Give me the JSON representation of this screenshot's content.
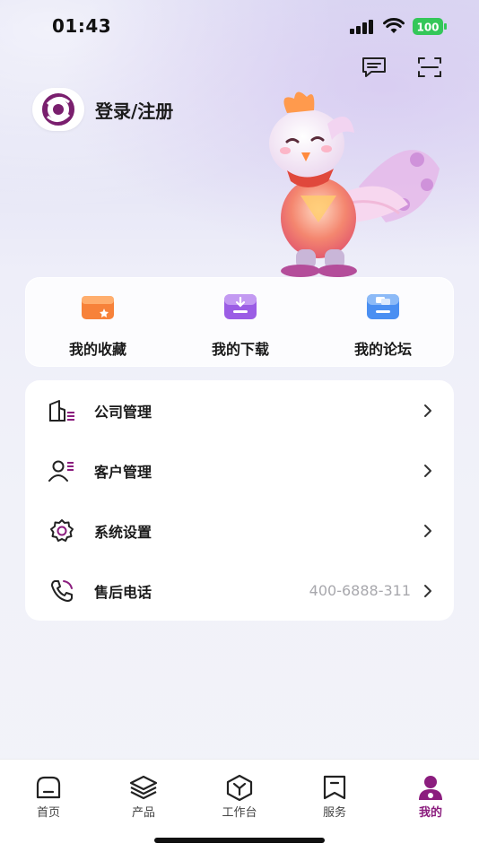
{
  "status_bar": {
    "time": "01:43",
    "battery": "100"
  },
  "header": {
    "message_icon": "message-icon",
    "scan_icon": "scan-icon",
    "login_label": "登录/注册"
  },
  "quick_actions": [
    {
      "label": "我的收藏",
      "icon": "favorites-icon"
    },
    {
      "label": "我的下载",
      "icon": "download-icon"
    },
    {
      "label": "我的论坛",
      "icon": "forum-icon"
    }
  ],
  "menu": [
    {
      "label": "公司管理",
      "icon": "company-icon",
      "value": ""
    },
    {
      "label": "客户管理",
      "icon": "customer-icon",
      "value": ""
    },
    {
      "label": "系统设置",
      "icon": "settings-icon",
      "value": ""
    },
    {
      "label": "售后电话",
      "icon": "phone-icon",
      "value": "400-6888-311"
    }
  ],
  "tabs": [
    {
      "label": "首页",
      "icon": "home-icon",
      "active": false
    },
    {
      "label": "产品",
      "icon": "layers-icon",
      "active": false
    },
    {
      "label": "工作台",
      "icon": "workbench-icon",
      "active": false
    },
    {
      "label": "服务",
      "icon": "bookmark-icon",
      "active": false
    },
    {
      "label": "我的",
      "icon": "profile-icon",
      "active": true
    }
  ],
  "colors": {
    "accent": "#8b1d7e",
    "muted": "#a8a8ad"
  }
}
